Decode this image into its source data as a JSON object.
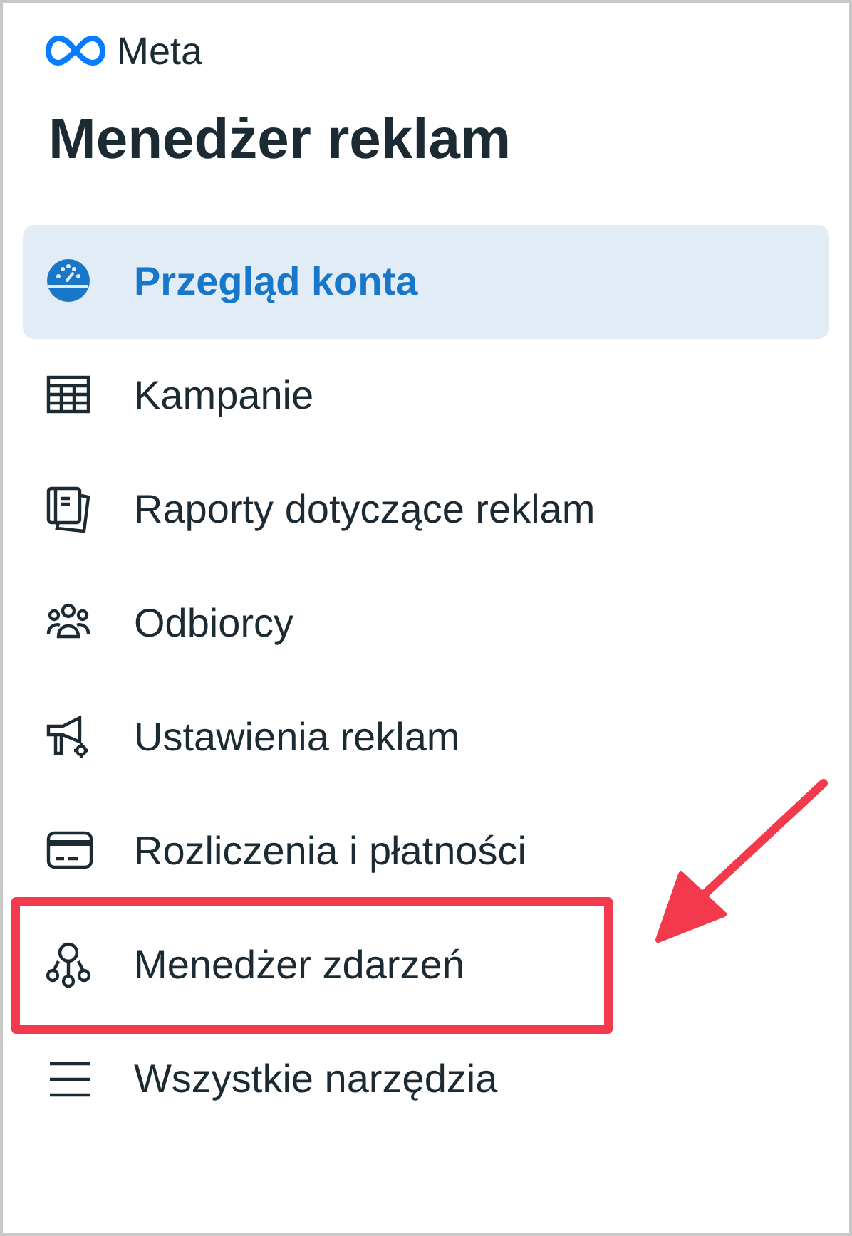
{
  "logo": {
    "text": "Meta"
  },
  "title": "Menedżer reklam",
  "nav": [
    {
      "label": "Przegląd konta",
      "selected": true,
      "highlighted": false
    },
    {
      "label": "Kampanie",
      "selected": false,
      "highlighted": false
    },
    {
      "label": "Raporty dotyczące reklam",
      "selected": false,
      "highlighted": false
    },
    {
      "label": "Odbiorcy",
      "selected": false,
      "highlighted": false
    },
    {
      "label": "Ustawienia reklam",
      "selected": false,
      "highlighted": false
    },
    {
      "label": "Rozliczenia i płatności",
      "selected": false,
      "highlighted": false
    },
    {
      "label": "Menedżer zdarzeń",
      "selected": false,
      "highlighted": true
    },
    {
      "label": "Wszystkie narzędzia",
      "selected": false,
      "highlighted": false
    }
  ]
}
